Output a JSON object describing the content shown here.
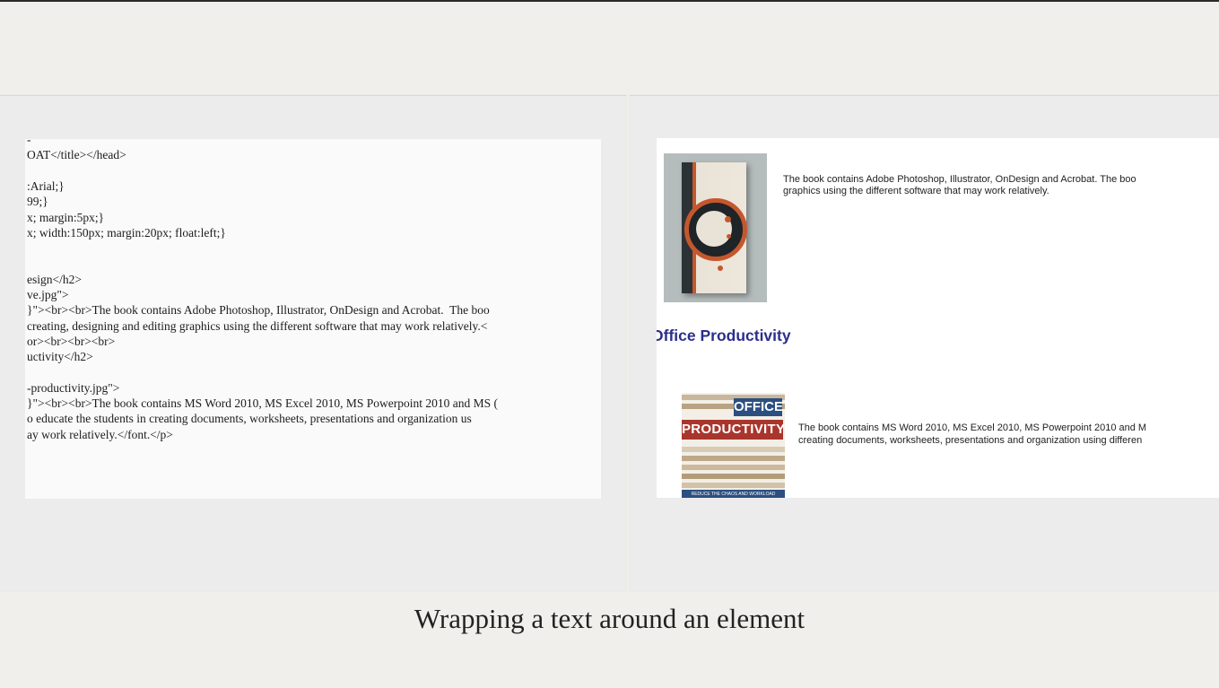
{
  "slide": {
    "caption": "Wrapping a text around an element"
  },
  "code_panel": {
    "lines": [
      "-",
      "OAT</title></head>",
      "",
      ":Arial;}",
      "99;}",
      "x; margin:5px;}",
      "x; width:150px; margin:20px; float:left;}",
      "",
      "",
      "esign</h2>",
      "ve.jpg\">",
      "}\"><br><br>The book contains Adobe Photoshop, Illustrator, OnDesign and Acrobat.  The boo",
      "creating, designing and editing graphics using the different software that may work relatively.<",
      "or><br><br><br>",
      "uctivity</h2>",
      "",
      "-productivity.jpg\">",
      "}\"><br><br>The book contains MS Word 2010, MS Excel 2010, MS Powerpoint 2010 and MS (",
      "o educate the students in creating documents, worksheets, presentations and organization us",
      "ay work relatively.</font.</p>"
    ]
  },
  "preview_panel": {
    "book1_text_line1": "The book contains Adobe Photoshop, Illustrator, OnDesign and Acrobat. The boo",
    "book1_text_line2": "graphics using the different software that may work relatively.",
    "heading": "Office Productivity",
    "book2_text_line1": "The book contains MS Word 2010, MS Excel 2010, MS Powerpoint 2010 and M",
    "book2_text_line2": "creating documents, worksheets, presentations and organization using differen",
    "book2_cover_title1": "OFFICE",
    "book2_cover_title2": "PRODUCTIVITY",
    "book2_cover_sub": "REDUCE THE CHAOS AND WORKLOAD"
  }
}
